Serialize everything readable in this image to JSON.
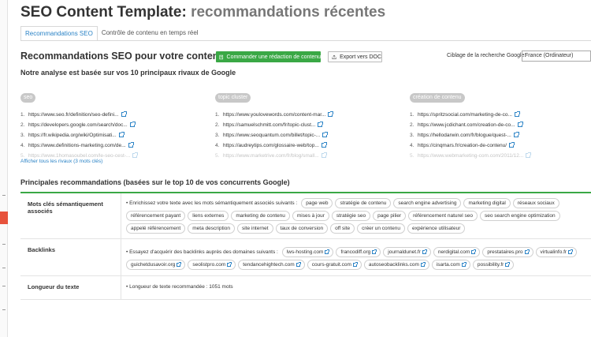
{
  "header": {
    "title_main": "SEO Content Template:",
    "title_sub": "recommandations récentes"
  },
  "tabs": [
    {
      "label": "Recommandations SEO",
      "active": true
    },
    {
      "label": "Contrôle de contenu en temps réel",
      "active": false
    }
  ],
  "toolbar": {
    "section_title": "Recommandations SEO pour votre contenu",
    "order_button": "Commander une rédaction de contenu",
    "export_button": "Export vers DOC",
    "geo_label": "Ciblage de la recherche Google:",
    "geo_value": "France (Ordinateur)"
  },
  "analysis": {
    "title": "Notre analyse est basée sur vos 10 principaux rivaux de Google",
    "columns": [
      {
        "keyword": "seo",
        "urls": [
          "https://www.seo.fr/definition/seo-defini...",
          "https://developers.google.com/search/doc...",
          "https://fr.wikipedia.org/wiki/Optimisati...",
          "https://www.definitions-marketing.com/de...",
          "https://www.1homasoubel.com/le-seo-cest-..."
        ]
      },
      {
        "keyword": "topic cluster",
        "urls": [
          "https://www.youlovewords.com/content-mar...",
          "https://samuelschmitt.com/fr/topic-clust...",
          "https://www.seoquantum.com/billet/topic-...",
          "https://audreytips.com/glossaire-web/top...",
          "https://www.marketrive.com/fr/blog/small..."
        ]
      },
      {
        "keyword": "création de contenu",
        "urls": [
          "https://spritzsocial.com/marketing-de-co...",
          "https://www.jcdichant.com/creation-de-co...",
          "https://hellodarwin.com/fr/blogue/quest-...",
          "https://cinqmars.fr/creation-de-contenu/",
          "https://www.webmarketing-com.com/2011/12..."
        ]
      }
    ],
    "show_all": "Afficher tous les rivaux (3 mots clés)"
  },
  "recommendations": {
    "title": "Principales recommandations (basées sur le top 10 de vos concurrents Google)",
    "semantic": {
      "label": "Mots clés sémantiquement associés",
      "intro": "Enrichissez votre texte avec les mots sémantiquement associés suivants :",
      "keywords": [
        "page web",
        "stratégie de contenu",
        "search engine advertising",
        "marketing digital",
        "réseaux sociaux",
        "référencement payant",
        "liens externes",
        "marketing de contenu",
        "mises à jour",
        "stratégie seo",
        "page pilier",
        "référencement naturel seo",
        "seo search engine optimization",
        "appelé référencement",
        "meta description",
        "site internet",
        "taux de conversion",
        "off site",
        "créer un contenu",
        "expérience utilisateur"
      ]
    },
    "backlinks": {
      "label": "Backlinks",
      "intro": "Essayez d'acquérir des backlinks auprès des domaines suivants :",
      "domains": [
        "lws-hosting.com",
        "francodiff.org",
        "journaldunet.fr",
        "nerdigital.com",
        "prestataires.pro",
        "virtualinfo.fr",
        "guichetdusavoir.org",
        "seolistpro.com",
        "tendancehightech.com",
        "cours-gratuit.com",
        "autoseobacklinks.com",
        "isarta.com",
        "possibility.fr"
      ]
    },
    "length": {
      "label": "Longueur du texte",
      "text": "Longueur de texte recommandée : 1051 mots"
    }
  }
}
